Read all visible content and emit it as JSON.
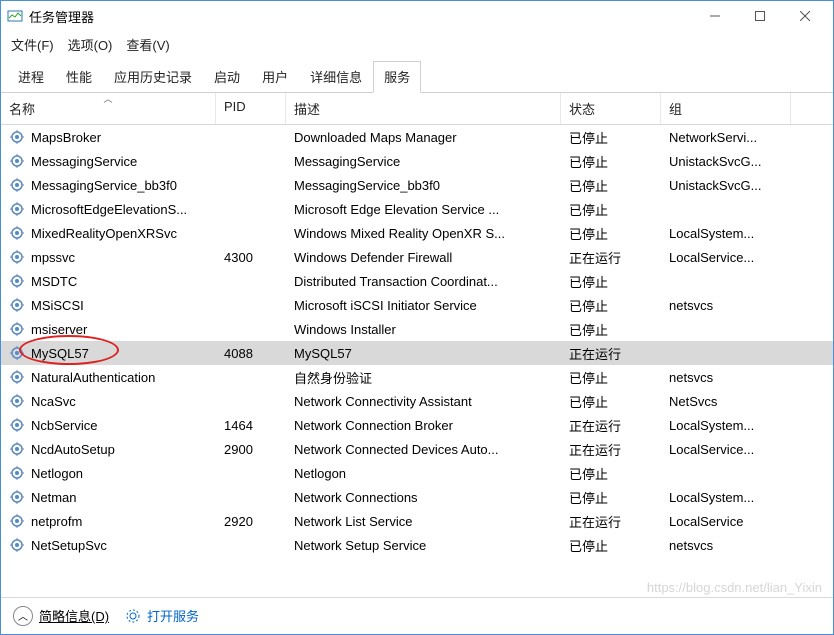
{
  "window": {
    "title": "任务管理器"
  },
  "menu": [
    "文件(F)",
    "选项(O)",
    "查看(V)"
  ],
  "tabs": [
    "进程",
    "性能",
    "应用历史记录",
    "启动",
    "用户",
    "详细信息",
    "服务"
  ],
  "active_tab": 6,
  "columns": {
    "name": "名称",
    "pid": "PID",
    "desc": "描述",
    "status": "状态",
    "group": "组"
  },
  "rows": [
    {
      "name": "MapsBroker",
      "pid": "",
      "desc": "Downloaded Maps Manager",
      "status": "已停止",
      "group": "NetworkServi..."
    },
    {
      "name": "MessagingService",
      "pid": "",
      "desc": "MessagingService",
      "status": "已停止",
      "group": "UnistackSvcG..."
    },
    {
      "name": "MessagingService_bb3f0",
      "pid": "",
      "desc": "MessagingService_bb3f0",
      "status": "已停止",
      "group": "UnistackSvcG..."
    },
    {
      "name": "MicrosoftEdgeElevationS...",
      "pid": "",
      "desc": "Microsoft Edge Elevation Service ...",
      "status": "已停止",
      "group": ""
    },
    {
      "name": "MixedRealityOpenXRSvc",
      "pid": "",
      "desc": "Windows Mixed Reality OpenXR S...",
      "status": "已停止",
      "group": "LocalSystem..."
    },
    {
      "name": "mpssvc",
      "pid": "4300",
      "desc": "Windows Defender Firewall",
      "status": "正在运行",
      "group": "LocalService..."
    },
    {
      "name": "MSDTC",
      "pid": "",
      "desc": "Distributed Transaction Coordinat...",
      "status": "已停止",
      "group": ""
    },
    {
      "name": "MSiSCSI",
      "pid": "",
      "desc": "Microsoft iSCSI Initiator Service",
      "status": "已停止",
      "group": "netsvcs"
    },
    {
      "name": "msiserver",
      "pid": "",
      "desc": "Windows Installer",
      "status": "已停止",
      "group": ""
    },
    {
      "name": "MySQL57",
      "pid": "4088",
      "desc": "MySQL57",
      "status": "正在运行",
      "group": "",
      "selected": true,
      "circled": true
    },
    {
      "name": "NaturalAuthentication",
      "pid": "",
      "desc": "自然身份验证",
      "status": "已停止",
      "group": "netsvcs"
    },
    {
      "name": "NcaSvc",
      "pid": "",
      "desc": "Network Connectivity Assistant",
      "status": "已停止",
      "group": "NetSvcs"
    },
    {
      "name": "NcbService",
      "pid": "1464",
      "desc": "Network Connection Broker",
      "status": "正在运行",
      "group": "LocalSystem..."
    },
    {
      "name": "NcdAutoSetup",
      "pid": "2900",
      "desc": "Network Connected Devices Auto...",
      "status": "正在运行",
      "group": "LocalService..."
    },
    {
      "name": "Netlogon",
      "pid": "",
      "desc": "Netlogon",
      "status": "已停止",
      "group": ""
    },
    {
      "name": "Netman",
      "pid": "",
      "desc": "Network Connections",
      "status": "已停止",
      "group": "LocalSystem..."
    },
    {
      "name": "netprofm",
      "pid": "2920",
      "desc": "Network List Service",
      "status": "正在运行",
      "group": "LocalService"
    },
    {
      "name": "NetSetupSvc",
      "pid": "",
      "desc": "Network Setup Service",
      "status": "已停止",
      "group": "netsvcs"
    }
  ],
  "status": {
    "less": "简略信息(D)",
    "open": "打开服务"
  },
  "watermark": "https://blog.csdn.net/lian_Yixin"
}
